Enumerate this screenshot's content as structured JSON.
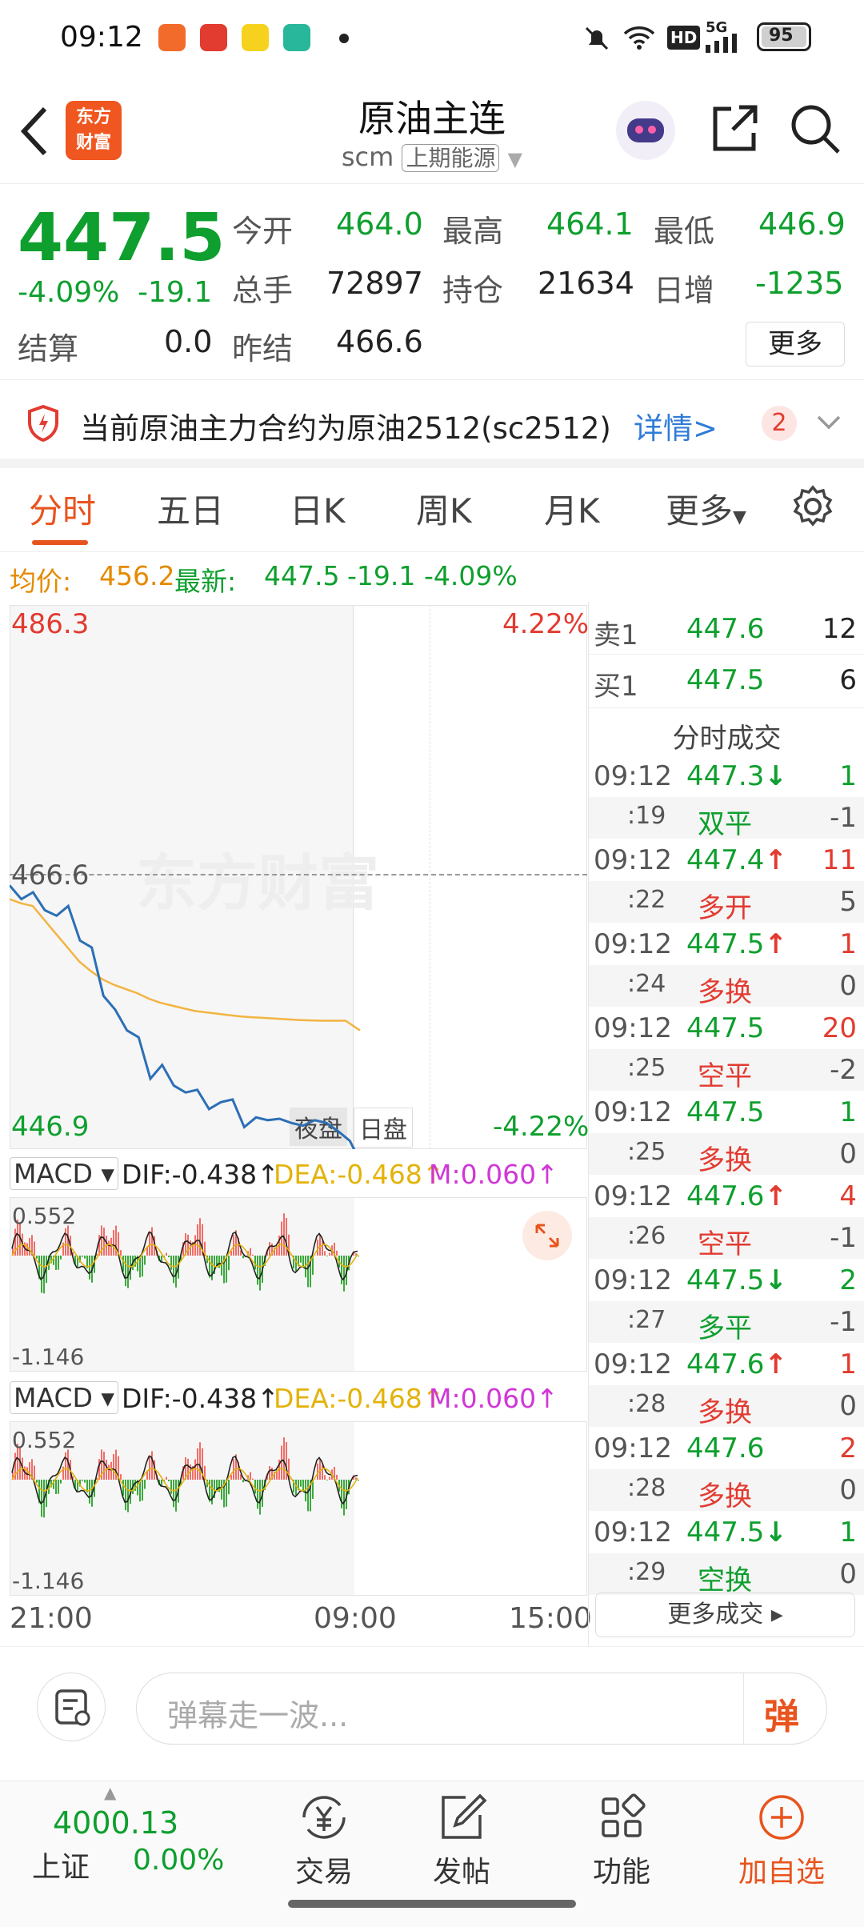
{
  "status_bar": {
    "time": "09:12",
    "battery": "95",
    "network": "5G",
    "hd": "HD"
  },
  "header": {
    "title": "原油主连",
    "code": "scm",
    "exchange": "上期能源",
    "logo_line1": "东方",
    "logo_line2": "财富"
  },
  "quote": {
    "price": "447.5",
    "change_pct": "-4.09%",
    "change": "-19.1",
    "open_label": "今开",
    "open": "464.0",
    "high_label": "最高",
    "high": "464.1",
    "low_label": "最低",
    "low": "446.9",
    "volume_label": "总手",
    "volume": "72897",
    "position_label": "持仓",
    "position": "21634",
    "daily_inc_label": "日增",
    "daily_inc": "-1235",
    "settle_label": "结算",
    "settle": "0.0",
    "prev_settle_label": "昨结",
    "prev_settle": "466.6",
    "more_label": "更多"
  },
  "notice": {
    "text": "当前原油主力合约为原油2512(sc2512)",
    "link": "详情>",
    "badge": "2"
  },
  "tabs": [
    {
      "label": "分时"
    },
    {
      "label": "五日"
    },
    {
      "label": "日K"
    },
    {
      "label": "周K"
    },
    {
      "label": "月K"
    },
    {
      "label": "更多"
    }
  ],
  "infoline": {
    "avg_label": "均价:",
    "avg": "456.2",
    "latest_label": "最新:",
    "latest": "447.5",
    "change": "-19.1",
    "pct": "-4.09%"
  },
  "chart": {
    "y_top": "486.3",
    "y_mid": "466.6",
    "y_bot": "446.9",
    "pct_top": "4.22%",
    "pct_bot": "-4.22%",
    "night_label": "夜盘",
    "day_label": "日盘",
    "watermark": "东方财富",
    "x_labels": [
      "21:00",
      "09:00",
      "15:00"
    ],
    "price_series": [
      466,
      465,
      465.5,
      464.2,
      463.8,
      464.5,
      462,
      461.5,
      458,
      457,
      455.5,
      455,
      452,
      453,
      451.5,
      451,
      451.2,
      449.8,
      450.3,
      450.5,
      448.5,
      449.2,
      449,
      449.1,
      448.8,
      448.6,
      449,
      448.8,
      448.2,
      447.5,
      445.8
    ],
    "avg_series": [
      465,
      464.7,
      464.5,
      463.5,
      462.5,
      461.5,
      460.5,
      459.8,
      459.2,
      458.8,
      458.5,
      458.2,
      457.8,
      457.5,
      457.3,
      457.1,
      456.9,
      456.8,
      456.7,
      456.6,
      456.5,
      456.45,
      456.4,
      456.35,
      456.3,
      456.25,
      456.22,
      456.2,
      456.2,
      456.2,
      455.5
    ],
    "macd1": {
      "label": "MACD",
      "dif": "DIF:-0.438",
      "dea": "DEA:-0.468",
      "m": "M:0.060",
      "top": "0.552",
      "bot": "-1.146"
    },
    "macd2": {
      "label": "MACD",
      "dif": "DIF:-0.438",
      "dea": "DEA:-0.468",
      "m": "M:0.060",
      "top": "0.552",
      "bot": "-1.146"
    }
  },
  "book": {
    "sell_label": "卖1",
    "sell_price": "447.6",
    "sell_vol": "12",
    "buy_label": "买1",
    "buy_price": "447.5",
    "buy_vol": "6",
    "ticks_title": "分时成交",
    "ticks": [
      {
        "time": "09:12",
        "price": "447.3",
        "arrow": "↓",
        "vol": "1",
        "sec": ":19",
        "type": "双平",
        "chg": "-1"
      },
      {
        "time": "09:12",
        "price": "447.4",
        "arrow": "↑",
        "vol": "11",
        "sec": ":22",
        "type": "多开",
        "chg": "5"
      },
      {
        "time": "09:12",
        "price": "447.5",
        "arrow": "↑",
        "vol": "1",
        "sec": ":24",
        "type": "多换",
        "chg": "0"
      },
      {
        "time": "09:12",
        "price": "447.5",
        "arrow": "",
        "vol": "20",
        "sec": ":25",
        "type": "空平",
        "chg": "-2"
      },
      {
        "time": "09:12",
        "price": "447.5",
        "arrow": "",
        "vol": "1",
        "sec": ":25",
        "type": "多换",
        "chg": "0"
      },
      {
        "time": "09:12",
        "price": "447.6",
        "arrow": "↑",
        "vol": "4",
        "sec": ":26",
        "type": "空平",
        "chg": "-1"
      },
      {
        "time": "09:12",
        "price": "447.5",
        "arrow": "↓",
        "vol": "2",
        "sec": ":27",
        "type": "多平",
        "chg": "-1"
      },
      {
        "time": "09:12",
        "price": "447.6",
        "arrow": "↑",
        "vol": "1",
        "sec": ":28",
        "type": "多换",
        "chg": "0"
      },
      {
        "time": "09:12",
        "price": "447.6",
        "arrow": "",
        "vol": "2",
        "sec": ":28",
        "type": "多换",
        "chg": "0"
      },
      {
        "time": "09:12",
        "price": "447.5",
        "arrow": "↓",
        "vol": "1",
        "sec": ":29",
        "type": "空换",
        "chg": "0"
      }
    ],
    "more_trades": "更多成交"
  },
  "comment": {
    "placeholder": "弹幕走一波...",
    "send": "弹"
  },
  "bottom": {
    "index_value": "4000.13",
    "index_name": "上证",
    "index_pct": "0.00%",
    "trade": "交易",
    "post": "发帖",
    "func": "功能",
    "add": "加自选"
  }
}
